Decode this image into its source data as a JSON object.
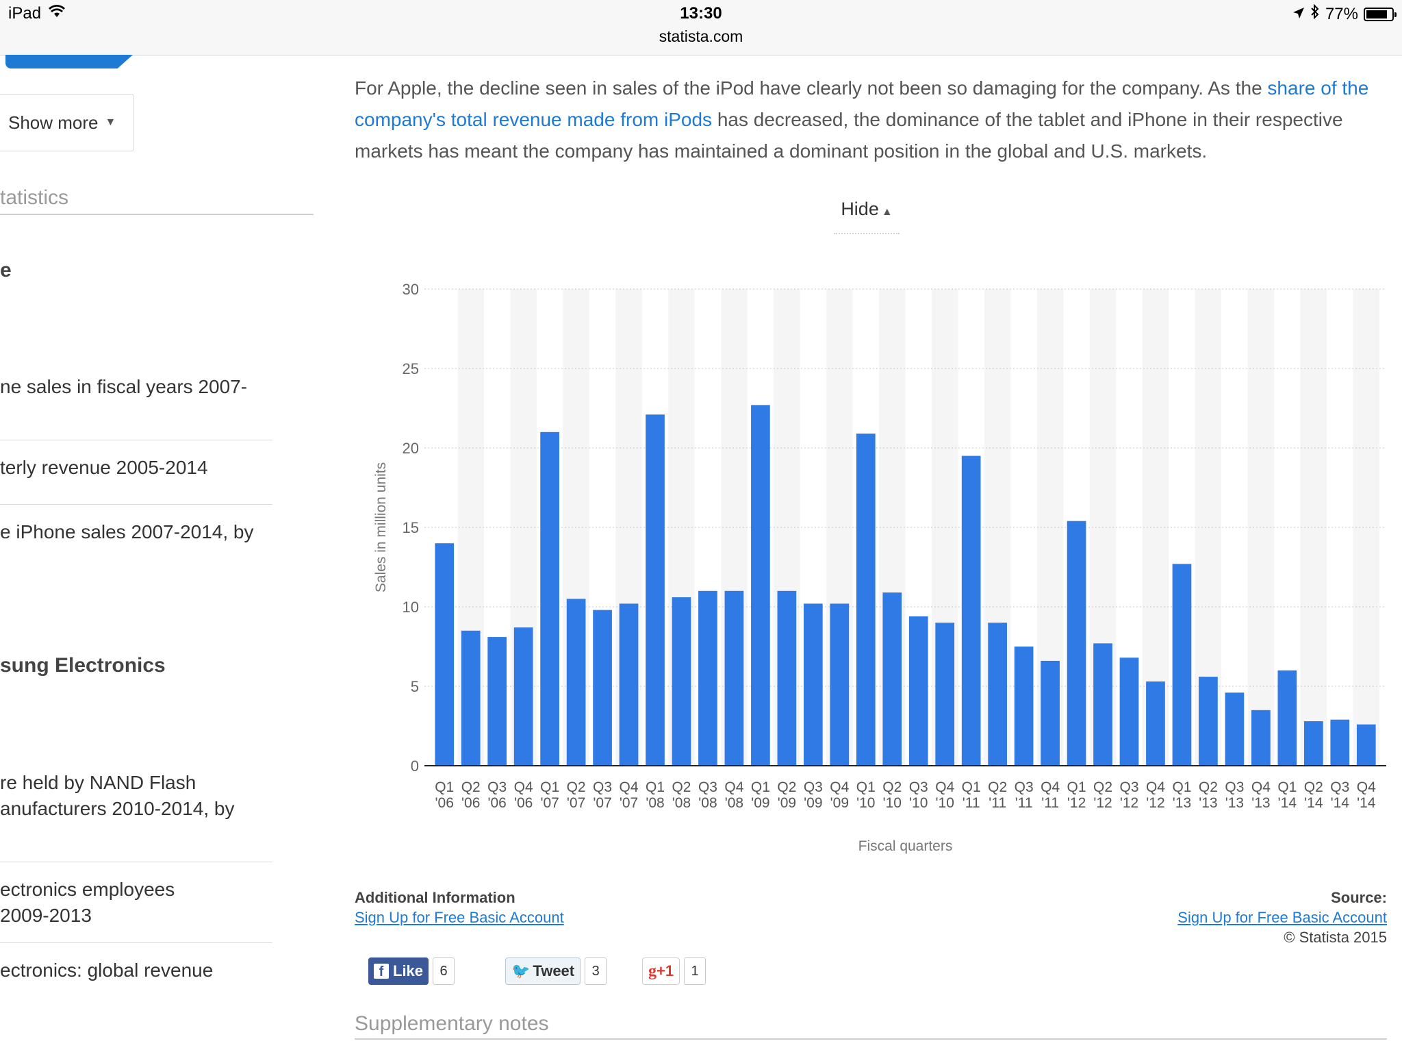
{
  "statusbar": {
    "device": "iPad",
    "time": "13:30",
    "url": "statista.com",
    "battery": "77%",
    "icons": [
      "wifi-icon",
      "location-arrow-icon",
      "bluetooth-icon",
      "battery-icon"
    ]
  },
  "sidebar": {
    "show_more": "Show more",
    "heading": "tatistics",
    "group1": "e",
    "links1": [
      "ne sales in fiscal years 2007-",
      "terly revenue 2005-2014",
      "e iPhone sales 2007-2014, by"
    ],
    "group2": "sung Electronics",
    "links2": [
      "re held by NAND Flash",
      "anufacturers 2010-2014, by",
      "ectronics employees",
      "2009-2013",
      "ectronics: global revenue"
    ]
  },
  "main": {
    "intro_part1": "For Apple, the decline seen in sales of the iPod have clearly not been so damaging for the company. As the ",
    "intro_link": "share of the company's total revenue made from iPods",
    "intro_part2": " has decreased, the dominance of the tablet and iPhone in their respective markets has meant the company has maintained a dominant position in the global and U.S. markets.",
    "hide": "Hide",
    "additional_info": "Additional Information",
    "signup": "Sign Up for Free Basic Account",
    "source_label": "Source:",
    "source_link": "Sign Up for Free Basic Account",
    "copyright": "© Statista 2015",
    "supplementary": "Supplementary notes"
  },
  "social": {
    "like": "Like",
    "like_count": "6",
    "tweet": "Tweet",
    "tweet_count": "3",
    "gplus": "+1",
    "gplus_count": "1"
  },
  "chart_data": {
    "type": "bar",
    "title": "",
    "xlabel": "Fiscal quarters",
    "ylabel": "Sales in million units",
    "ylim": [
      0,
      30
    ],
    "yticks": [
      0,
      5,
      10,
      15,
      20,
      25,
      30
    ],
    "color": "#2f7ae5",
    "categories": [
      "Q1 '06",
      "Q2 '06",
      "Q3 '06",
      "Q4 '06",
      "Q1 '07",
      "Q2 '07",
      "Q3 '07",
      "Q4 '07",
      "Q1 '08",
      "Q2 '08",
      "Q3 '08",
      "Q4 '08",
      "Q1 '09",
      "Q2 '09",
      "Q3 '09",
      "Q4 '09",
      "Q1 '10",
      "Q2 '10",
      "Q3 '10",
      "Q4 '10",
      "Q1 '11",
      "Q2 '11",
      "Q3 '11",
      "Q4 '11",
      "Q1 '12",
      "Q2 '12",
      "Q3 '12",
      "Q4 '12",
      "Q1 '13",
      "Q2 '13",
      "Q3 '13",
      "Q4 '13",
      "Q1 '14",
      "Q2 '14",
      "Q3 '14",
      "Q4 '14"
    ],
    "values": [
      14.0,
      8.5,
      8.1,
      8.7,
      21.0,
      10.5,
      9.8,
      10.2,
      22.1,
      10.6,
      11.0,
      11.0,
      22.7,
      11.0,
      10.2,
      10.2,
      20.9,
      10.9,
      9.4,
      9.0,
      19.5,
      9.0,
      7.5,
      6.6,
      15.4,
      7.7,
      6.8,
      5.3,
      12.7,
      5.6,
      4.6,
      3.5,
      6.0,
      2.8,
      2.9,
      2.6
    ]
  }
}
